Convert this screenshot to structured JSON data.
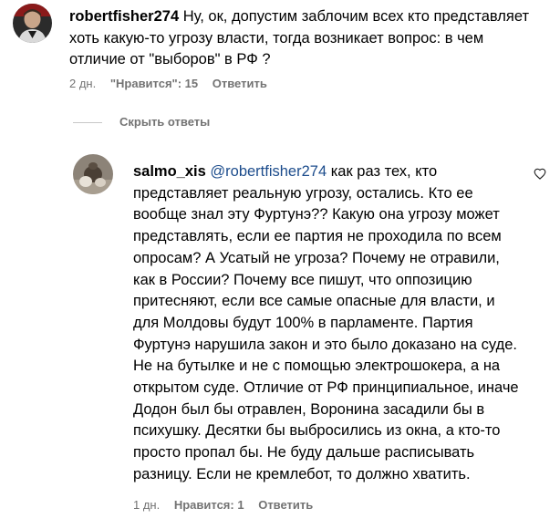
{
  "comment1": {
    "username": "robertfisher274",
    "text": " Ну, ок, допустим заблочим всех кто представляет хоть какую-то угрозу власти, тогда возникает вопрос: в чем отличие от \"выборов\" в РФ ?",
    "time": "2 дн.",
    "likes": "\"Нравится\": 15",
    "reply": "Ответить",
    "avatar_icon": "user-avatar-icon",
    "like_icon": "heart-outline-icon"
  },
  "replies_toggle": {
    "label": "Скрыть ответы"
  },
  "reply1": {
    "username": "salmo_xis",
    "mention": " @robertfisher274",
    "text": " как раз тех, кто представляет реальную угрозу, остались. Кто ее вообще знал эту Фуртунэ?? Какую она угрозу может представлять, если ее партия не проходила по всем опросам? А Усатый не угроза? Почему не отравили, как в России? Почему все пишут, что оппозицию притесняют, если все самые опасные для власти, и для Молдовы будут 100% в парламенте. Партия Фуртунэ нарушила закон и это было доказано на суде. Не на бутылке и не с помощью электрошокера, а на открытом суде. Отличие от РФ принципиальное, иначе Додон был бы отравлен, Воронина засадили бы в психушку. Десятки бы выбросились из окна, а кто-то просто пропал бы. Не буду дальше расписывать разницу. Если не кремлебот, то должно хватить.",
    "time": "1 дн.",
    "likes": "Нравится: 1",
    "reply": "Ответить",
    "avatar_icon": "user-avatar-icon",
    "like_icon": "heart-outline-icon"
  },
  "colors": {
    "text": "#000000",
    "meta": "#737373",
    "mention": "#1c4c8c",
    "divider": "#c7c7c7"
  }
}
